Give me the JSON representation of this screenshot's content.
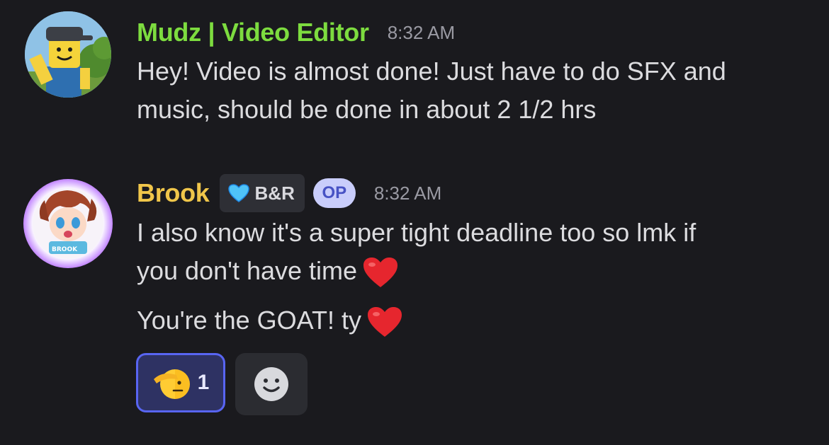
{
  "messages": [
    {
      "username": "Mudz | Video Editor",
      "username_color": "#7ddc3f",
      "timestamp": "8:32 AM",
      "avatar_icon": "roblox-avatar-icon",
      "lines": [
        "Hey! Video is almost done! Just have to do SFX and",
        "music, should be done in about 2 1/2 hrs"
      ]
    },
    {
      "username": "Brook",
      "username_color": "#f0c64a",
      "tag_label": "B&R",
      "tag_icon": "blue-heart-icon",
      "op_label": "OP",
      "timestamp": "8:32 AM",
      "avatar_icon": "anime-avatar-icon",
      "lines": [
        "I also know it's a super tight deadline too so lmk if",
        "you don't have time"
      ],
      "line2": "You're the GOAT! ty",
      "emoji": "red-heart-icon"
    }
  ],
  "reactions": [
    {
      "emoji": "saluting-face-icon",
      "count": "1",
      "active": true
    }
  ],
  "add_reaction_icon": "smiley-add-reaction-icon",
  "colors": {
    "background": "#1a1a1e",
    "accent": "#5865f2",
    "text": "#dcdcdf",
    "muted": "#9a9aa3"
  }
}
